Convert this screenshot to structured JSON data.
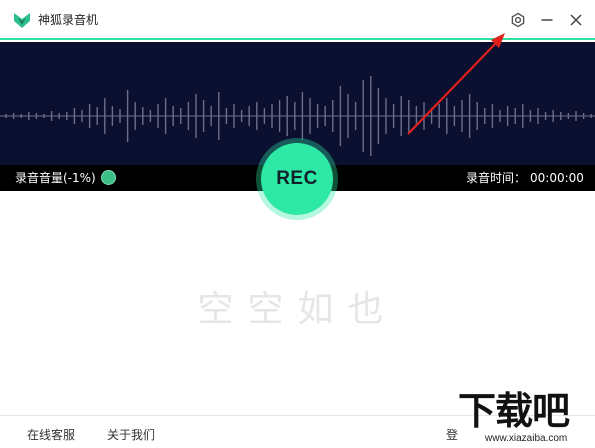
{
  "app": {
    "title": "神狐录音机"
  },
  "titlebar": {
    "settings_icon": "gear-icon",
    "minimize_icon": "minimize-icon",
    "close_icon": "close-icon"
  },
  "recorder": {
    "volume_label": "录音音量(-1%)",
    "time_label": "录音时间：",
    "time_value": "00:00:00",
    "rec_label": "REC"
  },
  "main": {
    "empty_text": "空空如也"
  },
  "footer": {
    "service_label": "在线客服",
    "about_label": "关于我们",
    "login_label": "登"
  },
  "watermark": {
    "brand": "下载吧",
    "url": "www.xiazaiba.com"
  },
  "colors": {
    "accent": "#2ee8a6",
    "wave_bg": "#0c1030",
    "wave_line": "#6b6f8c",
    "annotation_arrow": "#e0201a"
  }
}
